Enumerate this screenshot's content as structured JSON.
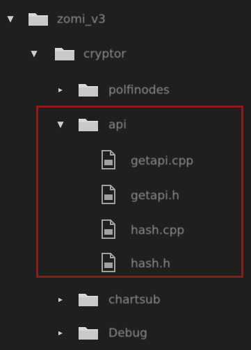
{
  "tree": {
    "nodes": [
      {
        "label": "zomi_v3",
        "kind": "folder",
        "expanded": true,
        "depth": 0
      },
      {
        "label": "cryptor",
        "kind": "folder",
        "expanded": true,
        "depth": 1
      },
      {
        "label": "polfinodes",
        "kind": "folder",
        "expanded": false,
        "depth": 2
      },
      {
        "label": "api",
        "kind": "folder",
        "expanded": true,
        "depth": 2
      },
      {
        "label": "getapi.cpp",
        "kind": "file",
        "depth": 3
      },
      {
        "label": "getapi.h",
        "kind": "file",
        "depth": 3
      },
      {
        "label": "hash.cpp",
        "kind": "file",
        "depth": 3
      },
      {
        "label": "hash.h",
        "kind": "file",
        "depth": 3
      },
      {
        "label": "chartsub",
        "kind": "folder",
        "expanded": false,
        "depth": 2
      },
      {
        "label": "Debug",
        "kind": "folder",
        "expanded": false,
        "depth": 2
      }
    ]
  },
  "colors": {
    "background": "#1f1f1f",
    "folder": "#d8d8d8",
    "file": "#a0a0a0",
    "highlight_border": "#8a1c1c"
  },
  "icons": {
    "expanded": "chevron-down-icon",
    "collapsed": "chevron-right-icon",
    "folder": "folder-icon",
    "file": "file-icon"
  }
}
